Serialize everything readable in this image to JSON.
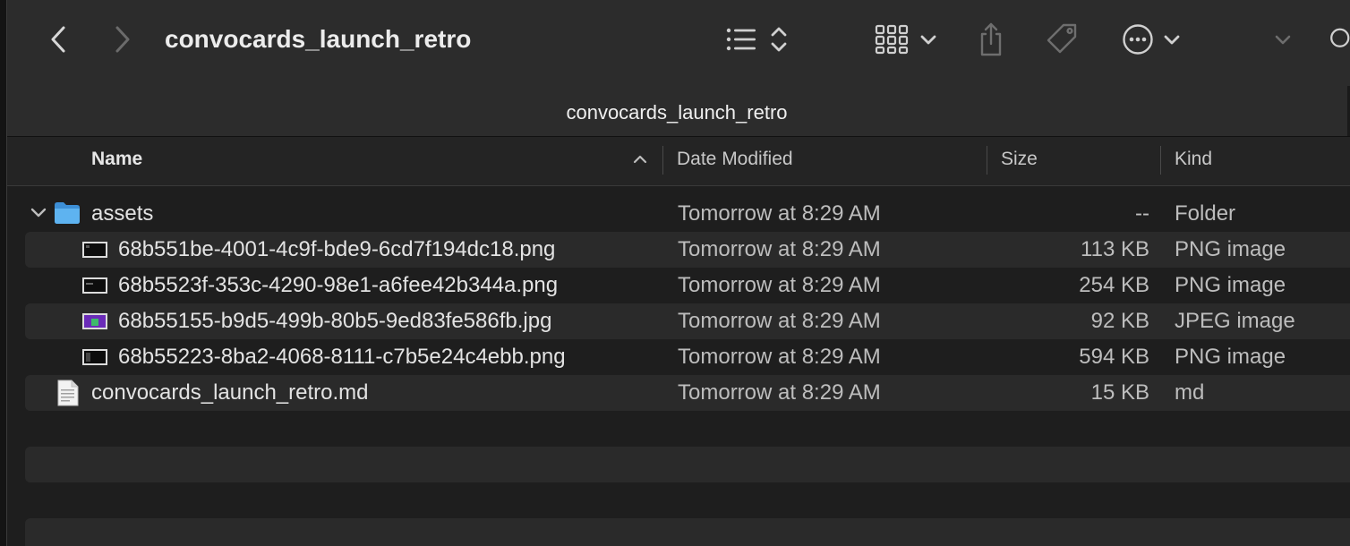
{
  "window": {
    "title": "convocards_launch_retro",
    "path_title": "convocards_launch_retro"
  },
  "toolbar": {
    "back_icon": "chevron-left-icon",
    "forward_icon": "chevron-right-icon",
    "view_list_icon": "list-view-icon",
    "sort_icon": "sort-updown-icon",
    "grid_view_icon": "icon-grid-view-icon",
    "share_icon": "share-icon",
    "tag_icon": "tag-icon",
    "more_icon": "ellipsis-circle-icon",
    "overflow_icon": "chevron-down-icon",
    "search_icon": "search-icon"
  },
  "columns": {
    "name": "Name",
    "date_modified": "Date Modified",
    "size": "Size",
    "kind": "Kind"
  },
  "rows": [
    {
      "name": "assets",
      "date": "Tomorrow at 8:29 AM",
      "size": "--",
      "kind": "Folder",
      "type": "folder",
      "level": 0,
      "expanded": true
    },
    {
      "name": "68b551be-4001-4c9f-bde9-6cd7f194dc18.png",
      "date": "Tomorrow at 8:29 AM",
      "size": "113 KB",
      "kind": "PNG image",
      "type": "image",
      "level": 1
    },
    {
      "name": "68b5523f-353c-4290-98e1-a6fee42b344a.png",
      "date": "Tomorrow at 8:29 AM",
      "size": "254 KB",
      "kind": "PNG image",
      "type": "image",
      "level": 1
    },
    {
      "name": "68b55155-b9d5-499b-80b5-9ed83fe586fb.jpg",
      "date": "Tomorrow at 8:29 AM",
      "size": "92 KB",
      "kind": "JPEG image",
      "type": "photo",
      "level": 1
    },
    {
      "name": "68b55223-8ba2-4068-8111-c7b5e24c4ebb.png",
      "date": "Tomorrow at 8:29 AM",
      "size": "594 KB",
      "kind": "PNG image",
      "type": "image",
      "level": 1
    },
    {
      "name": "convocards_launch_retro.md",
      "date": "Tomorrow at 8:29 AM",
      "size": "15 KB",
      "kind": "md",
      "type": "document",
      "level": 0
    }
  ],
  "colors": {
    "folder": "#4aa3e8",
    "background": "#1e1e1e",
    "toolbar": "#2c2c2c",
    "row_alt": "#2a2a2a"
  }
}
